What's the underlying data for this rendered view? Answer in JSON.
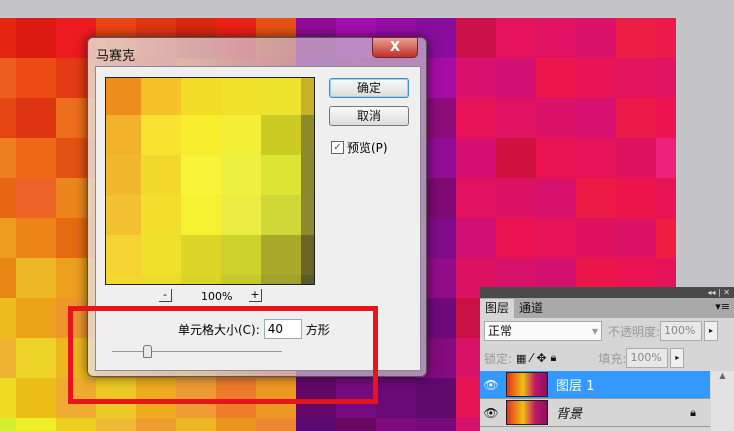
{
  "dialog": {
    "title": "马赛克",
    "close": "X",
    "ok": "确定",
    "cancel": "取消",
    "preview_label": "预览(P)",
    "preview_checked": true,
    "zoom_out": "-",
    "zoom_in": "+",
    "zoom_level": "100%",
    "cell_size_label": "单元格大小(C):",
    "cell_size_value": "40",
    "cell_unit": "方形",
    "slider_value": 40
  },
  "layers_panel": {
    "header_icons": "◂◂ | ✕",
    "tabs": [
      {
        "label": "图层"
      },
      {
        "label": "通道"
      }
    ],
    "menu_icon": "▾≡",
    "blend_mode": "正常",
    "opacity_label": "不透明度:",
    "opacity": "100%",
    "lock_label": "锁定:",
    "fill_label": "填充:",
    "fill": "100%",
    "layers": [
      {
        "name": "图层 1",
        "selected": true
      },
      {
        "name": "背景",
        "locked": true
      }
    ]
  },
  "colors": {
    "highlight": "#e8141c",
    "selected_layer": "#3399ff"
  }
}
